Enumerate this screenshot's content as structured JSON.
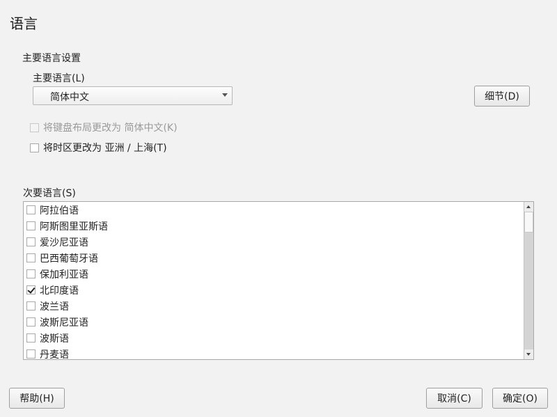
{
  "window": {
    "title": "语言"
  },
  "primary_section": {
    "heading": "主要语言设置",
    "language_label": "主要语言(L)",
    "language_value": "简体中文",
    "details_button": "细节(D)",
    "keyboard_option": "将键盘布局更改为 简体中文(K)",
    "keyboard_checked": false,
    "timezone_option": "将时区更改为 亚洲 / 上海(T)",
    "timezone_checked": false
  },
  "secondary_section": {
    "heading": "次要语言(S)",
    "languages": [
      {
        "label": "阿拉伯语",
        "checked": false
      },
      {
        "label": "阿斯图里亚斯语",
        "checked": false
      },
      {
        "label": "爱沙尼亚语",
        "checked": false
      },
      {
        "label": "巴西葡萄牙语",
        "checked": false
      },
      {
        "label": "保加利亚语",
        "checked": false
      },
      {
        "label": "北印度语",
        "checked": true
      },
      {
        "label": "波兰语",
        "checked": false
      },
      {
        "label": "波斯尼亚语",
        "checked": false
      },
      {
        "label": "波斯语",
        "checked": false
      },
      {
        "label": "丹麦语",
        "checked": false
      }
    ]
  },
  "footer": {
    "help_button": "帮助(H)",
    "cancel_button": "取消(C)",
    "ok_button": "确定(O)"
  },
  "icons": {
    "theme_toggle": "moon-icon"
  }
}
